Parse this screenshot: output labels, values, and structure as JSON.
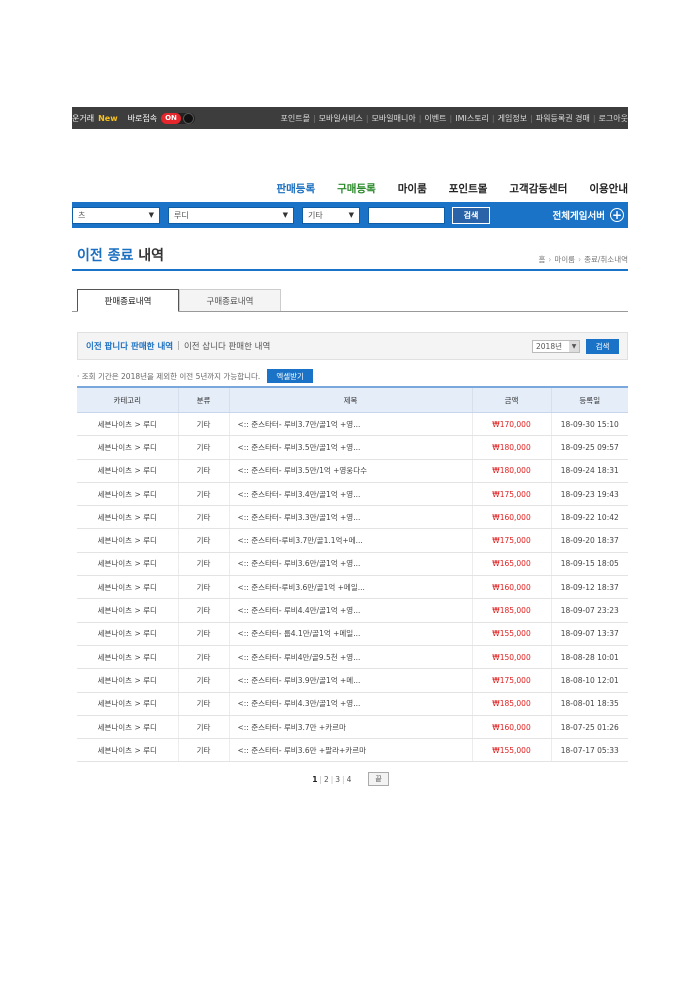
{
  "topbar": {
    "left_label": "운거래",
    "new_badge": "New",
    "quick_label": "바로접속",
    "toggle_label": "ON",
    "links": [
      "포인트몰",
      "모바일서비스",
      "모바일매니아",
      "이벤트",
      "IMI스토리",
      "게임정보",
      "파워등록권 경매",
      "로그아웃"
    ]
  },
  "mainnav": {
    "items": [
      "판매등록",
      "구매등록",
      "마이룸",
      "포인트몰",
      "고객감동센터",
      "이용안내"
    ]
  },
  "searchbar": {
    "game": "츠",
    "server": "루디",
    "category": "기타",
    "input_value": "",
    "button": "검색",
    "all_server": "전체게임서버"
  },
  "page": {
    "title_blue": "이전 종료",
    "title_dark": "내역",
    "breadcrumb": [
      "홈",
      "마이룸",
      "종료/취소내역"
    ]
  },
  "tabs": [
    "판매종료내역",
    "구매종료내역"
  ],
  "filter": {
    "active_label": "이전 팝니다 판매한 내역",
    "inactive_label": "이전 삽니다 판매한 내역",
    "year": "2018년",
    "button": "검색"
  },
  "notice": {
    "text": "· 조회 기간은 2018년을 제외한 이전 5년까지 가능합니다.",
    "excel_button": "엑셀받기"
  },
  "table": {
    "headers": [
      "카테고리",
      "분류",
      "제목",
      "금액",
      "등록일"
    ],
    "rows": [
      [
        "세븐나이츠 > 루디",
        "기타",
        "<:: 준스타터- 루비3.7만/골1억 +영...",
        "₩170,000",
        "18-09-30 15:10"
      ],
      [
        "세븐나이츠 > 루디",
        "기타",
        "<:: 준스타터- 루비3.5만/골1억 +영...",
        "₩180,000",
        "18-09-25 09:57"
      ],
      [
        "세븐나이츠 > 루디",
        "기타",
        "<:: 준스타터- 루비3.5만/1억 +영웅다수",
        "₩180,000",
        "18-09-24 18:31"
      ],
      [
        "세븐나이츠 > 루디",
        "기타",
        "<:: 준스타터- 루비3.4만/골1억 +영...",
        "₩175,000",
        "18-09-23 19:43"
      ],
      [
        "세븐나이츠 > 루디",
        "기타",
        "<:: 준스타터- 루비3.3만/골1억 +영...",
        "₩160,000",
        "18-09-22 10:42"
      ],
      [
        "세븐나이츠 > 루디",
        "기타",
        "<:: 준스타터-루비3.7만/골1.1억+메...",
        "₩175,000",
        "18-09-20 18:37"
      ],
      [
        "세븐나이츠 > 루디",
        "기타",
        "<:: 준스타터- 루비3.6만/골1억 +영...",
        "₩165,000",
        "18-09-15 18:05"
      ],
      [
        "세븐나이츠 > 루디",
        "기타",
        "<:: 준스타터-루비3.6만/골1억 +메일...",
        "₩160,000",
        "18-09-12 18:37"
      ],
      [
        "세븐나이츠 > 루디",
        "기타",
        "<:: 준스타터- 루비4.4만/골1억 +영...",
        "₩185,000",
        "18-09-07 23:23"
      ],
      [
        "세븐나이츠 > 루디",
        "기타",
        "<:: 준스타터- 룹4.1만/골1억 +메일...",
        "₩155,000",
        "18-09-07 13:37"
      ],
      [
        "세븐나이츠 > 루디",
        "기타",
        "<:: 준스타터- 루비4만/골9.5천 +영...",
        "₩150,000",
        "18-08-28 10:01"
      ],
      [
        "세븐나이츠 > 루디",
        "기타",
        "<:: 준스타터- 루비3.9만/골1억 +메...",
        "₩175,000",
        "18-08-10 12:01"
      ],
      [
        "세븐나이츠 > 루디",
        "기타",
        "<:: 준스타터- 루비4.3만/골1억 +영...",
        "₩185,000",
        "18-08-01 18:35"
      ],
      [
        "세븐나이츠 > 루디",
        "기타",
        "<:: 준스타터- 루비3.7만 +카르마",
        "₩160,000",
        "18-07-25 01:26"
      ],
      [
        "세븐나이츠 > 루디",
        "기타",
        "<:: 준스타터- 루비3.6만 +팔라+카르마",
        "₩155,000",
        "18-07-17 05:33"
      ]
    ]
  },
  "pager": {
    "pages": [
      "1",
      "2",
      "3",
      "4"
    ],
    "current": "1",
    "next": "끝"
  },
  "colors": {
    "accent_blue": "#1a73c6",
    "price_red": "#e02020",
    "topbar_bg": "#3d3d3d"
  }
}
